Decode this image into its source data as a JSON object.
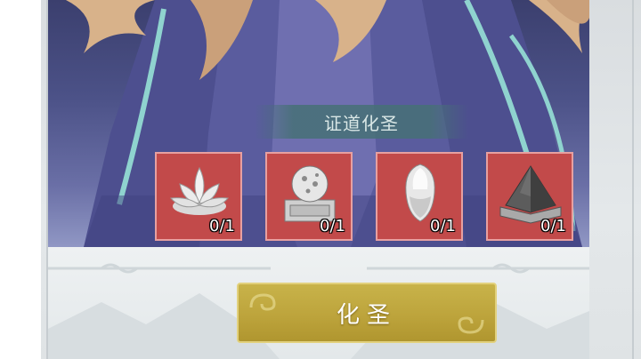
{
  "colors": {
    "slot_background": "#c24a4a",
    "button_gold": "#c8b34a",
    "banner_teal": "#467076"
  },
  "panel": {
    "title": "证道化圣"
  },
  "items": [
    {
      "name": "lotus-icon",
      "count": "0/1"
    },
    {
      "name": "orb-pedestal-icon",
      "count": "0/1"
    },
    {
      "name": "crystal-shard-icon",
      "count": "0/1"
    },
    {
      "name": "pyramid-stone-icon",
      "count": "0/1"
    }
  ],
  "action": {
    "ascend_label": "化圣"
  }
}
